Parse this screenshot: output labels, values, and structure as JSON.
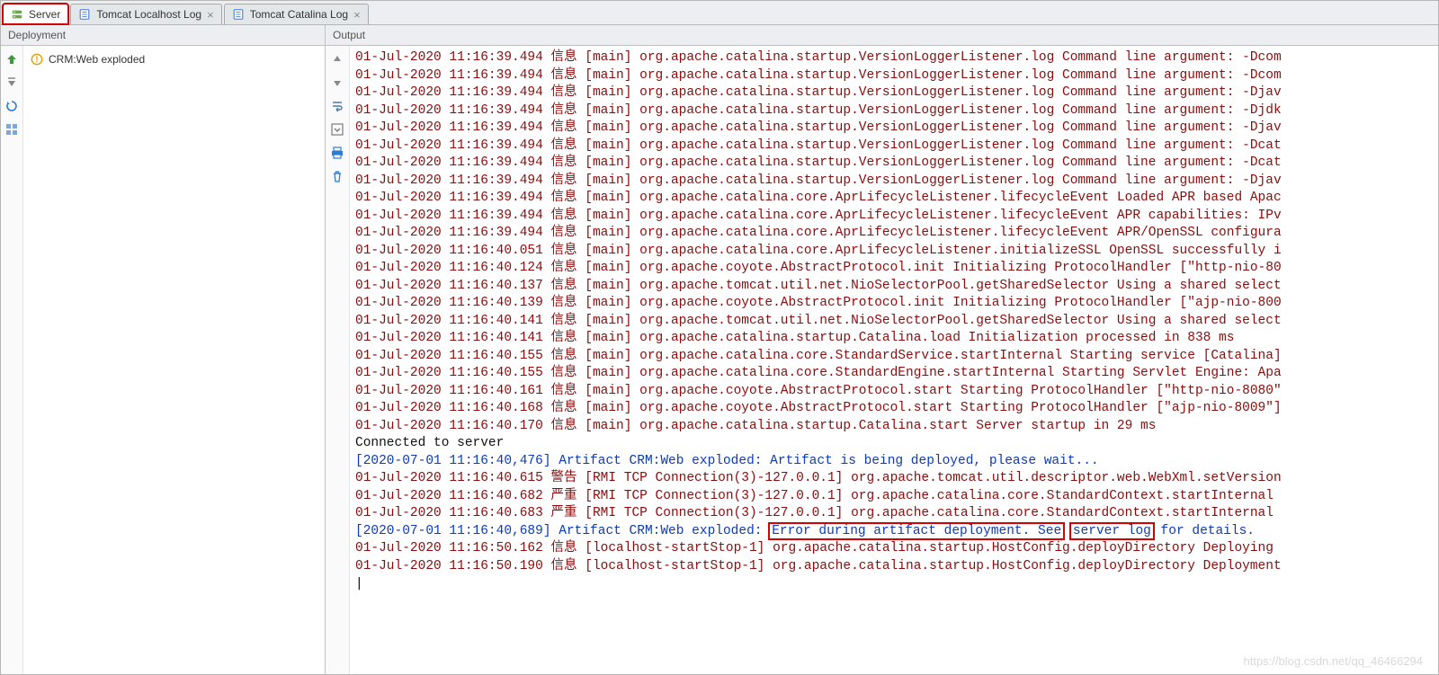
{
  "tabs": {
    "items": [
      {
        "label": "Server",
        "has_close": false,
        "active": true,
        "highlight": true,
        "icon": "server"
      },
      {
        "label": "Tomcat Localhost Log",
        "has_close": true,
        "active": false,
        "highlight": false,
        "icon": "log"
      },
      {
        "label": "Tomcat Catalina Log",
        "has_close": true,
        "active": false,
        "highlight": false,
        "icon": "log"
      }
    ]
  },
  "panels": {
    "left_title": "Deployment",
    "right_title": "Output"
  },
  "deployment": {
    "artifact": "CRM:Web exploded"
  },
  "left_toolbar": [
    {
      "name": "deploy-all-icon"
    },
    {
      "name": "undeploy-icon"
    },
    {
      "name": "refresh-icon"
    },
    {
      "name": "artifacts-icon"
    }
  ],
  "right_toolbar": [
    {
      "name": "scroll-up-icon"
    },
    {
      "name": "scroll-down-icon"
    },
    {
      "name": "soft-wrap-icon"
    },
    {
      "name": "scroll-to-end-icon"
    },
    {
      "name": "print-icon"
    },
    {
      "name": "clear-all-icon"
    }
  ],
  "log_lines": [
    {
      "cls": "c-red",
      "t": "01-Jul-2020 11:16:39.494 信息 [main] org.apache.catalina.startup.VersionLoggerListener.log Command line argument: -Dcom"
    },
    {
      "cls": "c-red",
      "t": "01-Jul-2020 11:16:39.494 信息 [main] org.apache.catalina.startup.VersionLoggerListener.log Command line argument: -Dcom"
    },
    {
      "cls": "c-red",
      "t": "01-Jul-2020 11:16:39.494 信息 [main] org.apache.catalina.startup.VersionLoggerListener.log Command line argument: -Djav"
    },
    {
      "cls": "c-red",
      "t": "01-Jul-2020 11:16:39.494 信息 [main] org.apache.catalina.startup.VersionLoggerListener.log Command line argument: -Djdk"
    },
    {
      "cls": "c-red",
      "t": "01-Jul-2020 11:16:39.494 信息 [main] org.apache.catalina.startup.VersionLoggerListener.log Command line argument: -Djav"
    },
    {
      "cls": "c-red",
      "t": "01-Jul-2020 11:16:39.494 信息 [main] org.apache.catalina.startup.VersionLoggerListener.log Command line argument: -Dcat"
    },
    {
      "cls": "c-red",
      "t": "01-Jul-2020 11:16:39.494 信息 [main] org.apache.catalina.startup.VersionLoggerListener.log Command line argument: -Dcat"
    },
    {
      "cls": "c-red",
      "t": "01-Jul-2020 11:16:39.494 信息 [main] org.apache.catalina.startup.VersionLoggerListener.log Command line argument: -Djav"
    },
    {
      "cls": "c-red",
      "t": "01-Jul-2020 11:16:39.494 信息 [main] org.apache.catalina.core.AprLifecycleListener.lifecycleEvent Loaded APR based Apac"
    },
    {
      "cls": "c-red",
      "t": "01-Jul-2020 11:16:39.494 信息 [main] org.apache.catalina.core.AprLifecycleListener.lifecycleEvent APR capabilities: IPv"
    },
    {
      "cls": "c-red",
      "t": "01-Jul-2020 11:16:39.494 信息 [main] org.apache.catalina.core.AprLifecycleListener.lifecycleEvent APR/OpenSSL configura"
    },
    {
      "cls": "c-red",
      "t": "01-Jul-2020 11:16:40.051 信息 [main] org.apache.catalina.core.AprLifecycleListener.initializeSSL OpenSSL successfully i"
    },
    {
      "cls": "c-red",
      "t": "01-Jul-2020 11:16:40.124 信息 [main] org.apache.coyote.AbstractProtocol.init Initializing ProtocolHandler [\"http-nio-80"
    },
    {
      "cls": "c-red",
      "t": "01-Jul-2020 11:16:40.137 信息 [main] org.apache.tomcat.util.net.NioSelectorPool.getSharedSelector Using a shared select"
    },
    {
      "cls": "c-red",
      "t": "01-Jul-2020 11:16:40.139 信息 [main] org.apache.coyote.AbstractProtocol.init Initializing ProtocolHandler [\"ajp-nio-800"
    },
    {
      "cls": "c-red",
      "t": "01-Jul-2020 11:16:40.141 信息 [main] org.apache.tomcat.util.net.NioSelectorPool.getSharedSelector Using a shared select"
    },
    {
      "cls": "c-red",
      "t": "01-Jul-2020 11:16:40.141 信息 [main] org.apache.catalina.startup.Catalina.load Initialization processed in 838 ms"
    },
    {
      "cls": "c-red",
      "t": "01-Jul-2020 11:16:40.155 信息 [main] org.apache.catalina.core.StandardService.startInternal Starting service [Catalina]"
    },
    {
      "cls": "c-red",
      "t": "01-Jul-2020 11:16:40.155 信息 [main] org.apache.catalina.core.StandardEngine.startInternal Starting Servlet Engine: Apa"
    },
    {
      "cls": "c-red",
      "t": "01-Jul-2020 11:16:40.161 信息 [main] org.apache.coyote.AbstractProtocol.start Starting ProtocolHandler [\"http-nio-8080\""
    },
    {
      "cls": "c-red",
      "t": "01-Jul-2020 11:16:40.168 信息 [main] org.apache.coyote.AbstractProtocol.start Starting ProtocolHandler [\"ajp-nio-8009\"]"
    },
    {
      "cls": "c-red",
      "t": "01-Jul-2020 11:16:40.170 信息 [main] org.apache.catalina.startup.Catalina.start Server startup in 29 ms"
    },
    {
      "cls": "c-black",
      "t": "Connected to server"
    },
    {
      "cls": "c-blue",
      "t": "[2020-07-01 11:16:40,476] Artifact CRM:Web exploded: Artifact is being deployed, please wait..."
    },
    {
      "cls": "c-red",
      "t": "01-Jul-2020 11:16:40.615 警告 [RMI TCP Connection(3)-127.0.0.1] org.apache.tomcat.util.descriptor.web.WebXml.setVersion"
    },
    {
      "cls": "c-red",
      "t": "01-Jul-2020 11:16:40.682 严重 [RMI TCP Connection(3)-127.0.0.1] org.apache.catalina.core.StandardContext.startInternal "
    },
    {
      "cls": "c-red",
      "t": "01-Jul-2020 11:16:40.683 严重 [RMI TCP Connection(3)-127.0.0.1] org.apache.catalina.core.StandardContext.startInternal "
    }
  ],
  "error_line": {
    "prefix": "[2020-07-01 11:16:40,689] Artifact CRM:Web exploded: ",
    "box1": "Error during artifact deployment. See",
    "mid": " ",
    "box2": "server log",
    "suffix": " for details."
  },
  "tail_lines": [
    {
      "cls": "c-red",
      "t": "01-Jul-2020 11:16:50.162 信息 [localhost-startStop-1] org.apache.catalina.startup.HostConfig.deployDirectory Deploying "
    },
    {
      "cls": "c-red",
      "t": "01-Jul-2020 11:16:50.190 信息 [localhost-startStop-1] org.apache.catalina.startup.HostConfig.deployDirectory Deployment"
    }
  ],
  "watermark": "https://blog.csdn.net/qq_46466294"
}
